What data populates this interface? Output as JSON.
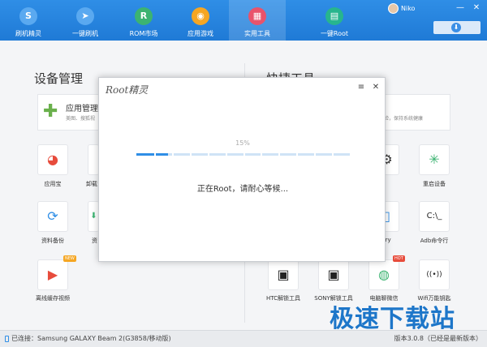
{
  "topbar": {
    "tabs": [
      {
        "label": "刷机精灵",
        "icon": "shield-icon",
        "color": "#5aa9f0",
        "glyph": "S"
      },
      {
        "label": "一键刷机",
        "icon": "cursor-icon",
        "color": "#5aa9f0",
        "glyph": "➤"
      },
      {
        "label": "ROM市场",
        "icon": "rom-icon",
        "color": "#3cb371",
        "glyph": "R"
      },
      {
        "label": "应用游戏",
        "icon": "app-game-icon",
        "color": "#f5a623",
        "glyph": "◉"
      },
      {
        "label": "实用工具",
        "icon": "tools-grid-icon",
        "color": "#e9536b",
        "glyph": "▦"
      },
      {
        "label": "一键Root",
        "icon": "root-icon",
        "color": "#27b58e",
        "glyph": "▤"
      }
    ],
    "user": "Niko",
    "win_buttons": [
      "—",
      "✕"
    ]
  },
  "left": {
    "title": "设备管理",
    "card_title": "应用管理",
    "card_sub": "美图、搜狐视",
    "tools": [
      {
        "label": "应用宝",
        "icon": "yingyongbao-icon",
        "glyph": "◕",
        "color": "#e74c3c"
      },
      {
        "label": "卸载",
        "icon": "uninstall-icon",
        "glyph": "▮",
        "color": "#e74c3c"
      },
      {
        "label": "资料备份",
        "icon": "backup-icon",
        "glyph": "⟳",
        "color": "#2f8ee6"
      },
      {
        "label": "资",
        "icon": "restore-icon",
        "glyph": "⬇",
        "color": "#3cb371"
      },
      {
        "label": "离线缓存视频",
        "icon": "video-cache-icon",
        "glyph": "▶",
        "color": "#e74c3c",
        "badge": "NEW"
      }
    ]
  },
  "right": {
    "title": "快捷工具",
    "card_sub": "检，保持系统健康",
    "tools": [
      {
        "label": "设置",
        "icon": "settings-icon",
        "glyph": "⚙",
        "color": "#333"
      },
      {
        "label": "重启设备",
        "icon": "reboot-icon",
        "glyph": "✳",
        "color": "#3cb371"
      },
      {
        "label": "covery",
        "icon": "recovery-icon",
        "glyph": "▯",
        "color": "#2f8ee6"
      },
      {
        "label": "Adb命令行",
        "icon": "adb-terminal-icon",
        "glyph": "C:\\_",
        "color": "#222"
      },
      {
        "label": "HTC解锁工具",
        "icon": "htc-lock-icon",
        "glyph": "🔒",
        "color": "#222"
      },
      {
        "label": "SONY解锁工具",
        "icon": "sony-lock-icon",
        "glyph": "🔒",
        "color": "#222"
      },
      {
        "label": "电脑聊微信",
        "icon": "wechat-icon",
        "glyph": "◍",
        "color": "#3cb371",
        "badge": "HOT"
      },
      {
        "label": "Wifi万能钥匙",
        "icon": "wifi-key-icon",
        "glyph": "((•))",
        "color": "#222"
      }
    ]
  },
  "modal": {
    "title": "Root精灵",
    "menu_glyph": "≡",
    "close_glyph": "✕",
    "percent_text": "15%",
    "progress": 0.15,
    "message": "正在Root，请耐心等候..."
  },
  "status": {
    "connected": "已连接：Samsung GALAXY Beam 2(G3858/移动版)",
    "version": "版本3.0.8（已经是最新版本）"
  },
  "watermark": "极速下载站"
}
